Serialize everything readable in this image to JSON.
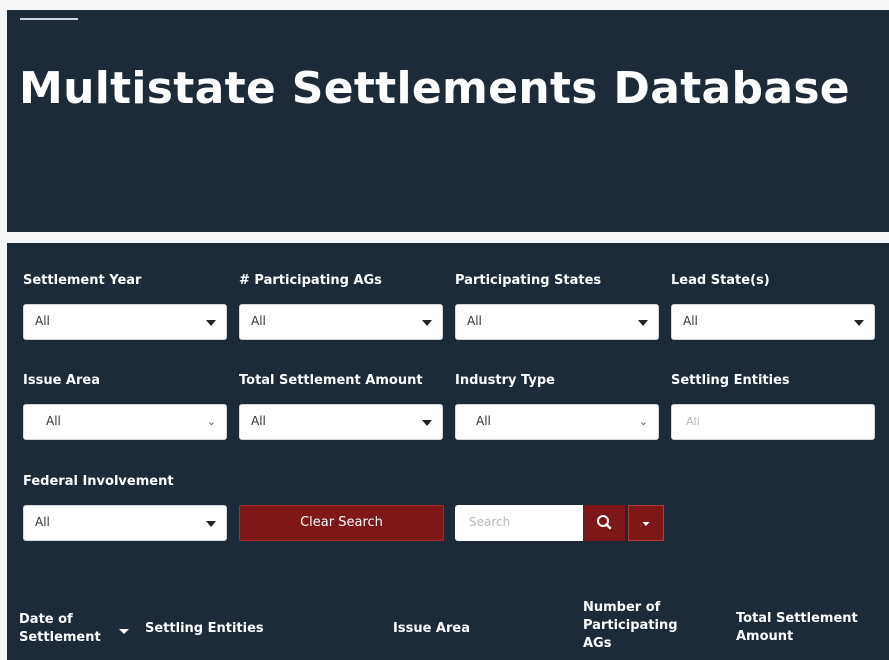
{
  "header": {
    "title": "Multistate Settlements Database"
  },
  "filters": {
    "settlement_year": {
      "label": "Settlement Year",
      "value": "All"
    },
    "participating_ags": {
      "label": "# Participating AGs",
      "value": "All"
    },
    "participating_states": {
      "label": "Participating States",
      "value": "All"
    },
    "lead_states": {
      "label": "Lead State(s)",
      "value": "All"
    },
    "issue_area": {
      "label": "Issue Area",
      "value": "All"
    },
    "total_amount": {
      "label": "Total Settlement Amount",
      "value": "All"
    },
    "industry_type": {
      "label": "Industry Type",
      "value": "All"
    },
    "settling_entities": {
      "label": "Settling Entities",
      "placeholder": "All"
    },
    "federal_involvement": {
      "label": "Federal Involvement",
      "value": "All"
    }
  },
  "actions": {
    "clear_label": "Clear Search",
    "search_placeholder": "Search"
  },
  "table": {
    "columns": [
      "Date of Settlement",
      "Settling Entities",
      "Issue Area",
      "Number of Participating AGs",
      "Total Settlement Amount"
    ]
  },
  "colors": {
    "navy": "#1d2b38",
    "accent": "#7e1818",
    "background": "#f4f5f6"
  },
  "icons": {
    "search": "search-icon",
    "dropdown": "caret-down-icon",
    "sort": "sort-caret-icon"
  }
}
